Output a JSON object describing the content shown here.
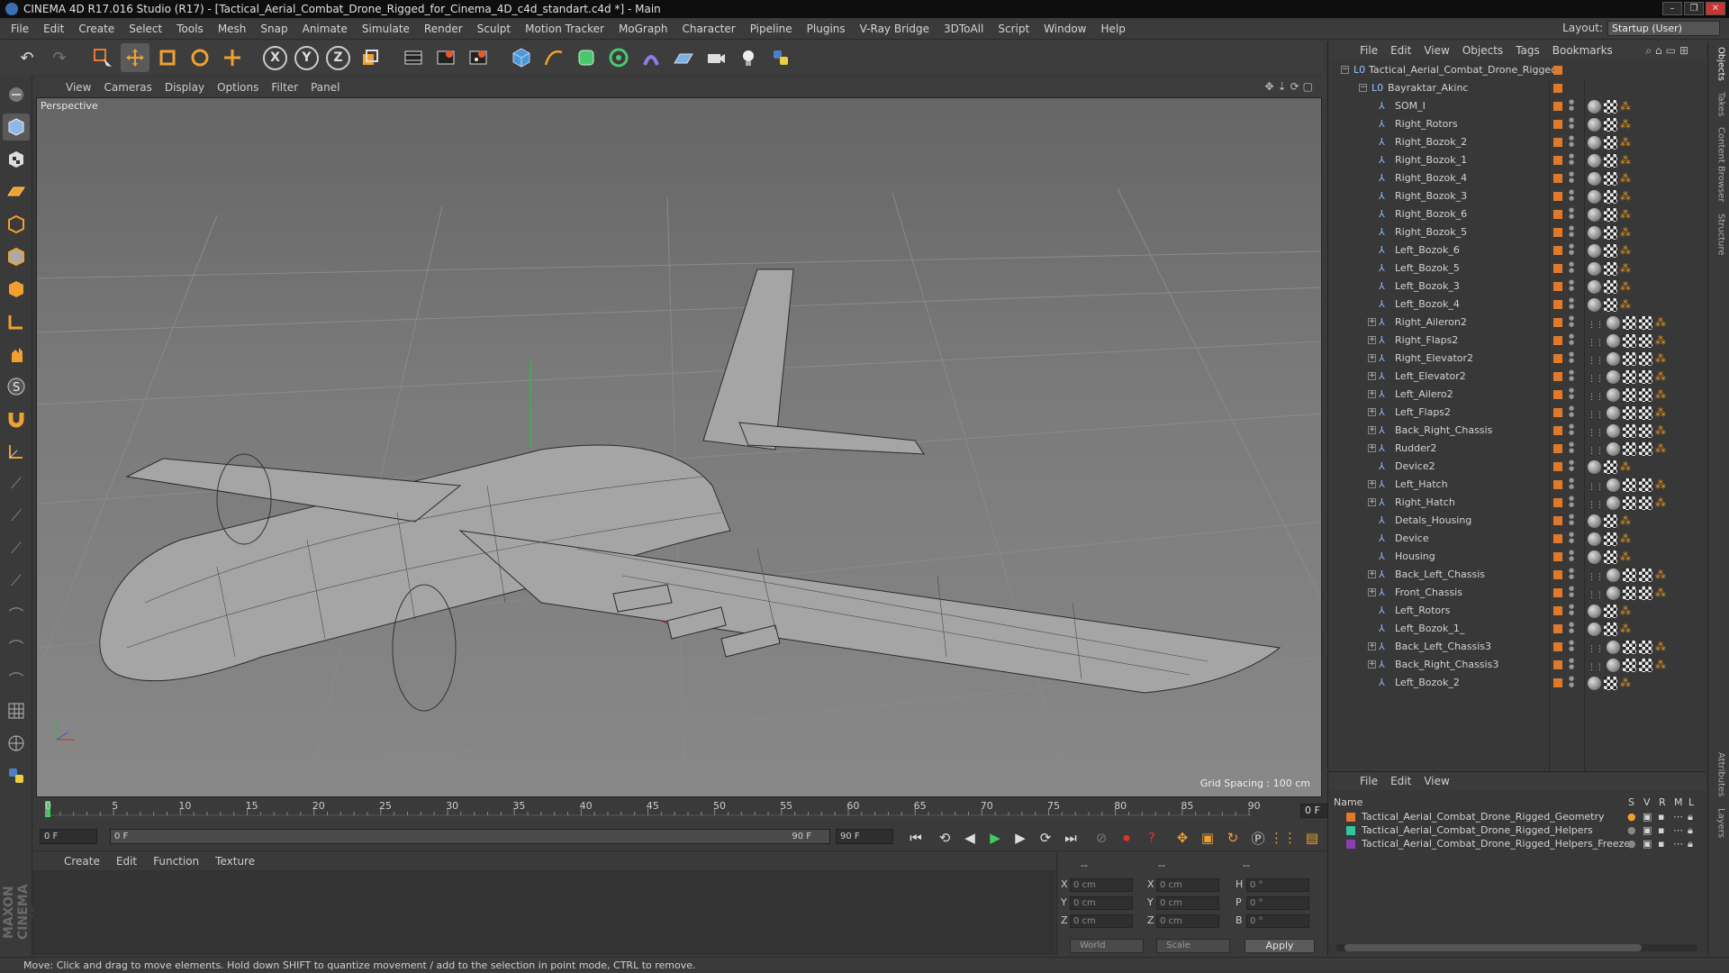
{
  "window": {
    "title": "CINEMA 4D R17.016 Studio (R17) - [Tactical_Aerial_Combat_Drone_Rigged_for_Cinema_4D_c4d_standart.c4d *] - Main"
  },
  "menu": [
    "File",
    "Edit",
    "Create",
    "Select",
    "Tools",
    "Mesh",
    "Snap",
    "Animate",
    "Simulate",
    "Render",
    "Sculpt",
    "Motion Tracker",
    "MoGraph",
    "Character",
    "Pipeline",
    "Plugins",
    "V-Ray Bridge",
    "3DToAll",
    "Script",
    "Window",
    "Help"
  ],
  "layout": {
    "label": "Layout:",
    "value": "Startup (User)"
  },
  "toolbar": {
    "undo_icon": "undo-icon",
    "redo_icon": "redo-icon",
    "live_select_icon": "live-selection-icon",
    "move_icon": "move-icon",
    "scale_icon": "scale-icon",
    "rotate_icon": "rotate-icon",
    "recent_icon": "recent-tool-icon",
    "axis_x": "X",
    "axis_y": "Y",
    "axis_z": "Z",
    "coord_icon": "coordinate-system-icon",
    "render_view_icon": "render-view-icon",
    "render_pic_icon": "render-picture-viewer-icon",
    "render_settings_icon": "render-settings-icon",
    "cube_icon": "cube-icon",
    "spline_icon": "spline-pen-icon",
    "nurbs_icon": "subdivision-icon",
    "array_icon": "array-icon",
    "deformer_icon": "deformer-icon",
    "floor_icon": "floor-icon",
    "camera_icon": "camera-icon",
    "light_icon": "light-icon",
    "python_icon": "python-icon"
  },
  "viewport": {
    "menu": [
      "View",
      "Cameras",
      "Display",
      "Options",
      "Filter",
      "Panel"
    ],
    "label": "Perspective",
    "grid_spacing": "Grid Spacing : 100 cm"
  },
  "timeline": {
    "ticks": [
      "0",
      "5",
      "10",
      "15",
      "20",
      "25",
      "30",
      "35",
      "40",
      "45",
      "50",
      "55",
      "60",
      "65",
      "70",
      "75",
      "80",
      "85",
      "90"
    ],
    "current_frame": "0 F"
  },
  "transport": {
    "start_field": "0 F",
    "range_start": "0 F",
    "range_end": "90 F",
    "end_field": "90 F"
  },
  "material_manager": {
    "menu": [
      "Create",
      "Edit",
      "Function",
      "Texture"
    ]
  },
  "coordinates": {
    "headers": [
      "--",
      "--",
      "--"
    ],
    "rows": [
      {
        "axis": "X",
        "pos": "0 cm",
        "axis2": "X",
        "size": "0 cm",
        "rl": "H",
        "rot": "0 °"
      },
      {
        "axis": "Y",
        "pos": "0 cm",
        "axis2": "Y",
        "size": "0 cm",
        "rl": "P",
        "rot": "0 °"
      },
      {
        "axis": "Z",
        "pos": "0 cm",
        "axis2": "Z",
        "size": "0 cm",
        "rl": "B",
        "rot": "0 °"
      }
    ],
    "space": "World",
    "mode": "Scale",
    "apply": "Apply"
  },
  "status": "Move: Click and drag to move elements. Hold down SHIFT to quantize movement / add to the selection in point mode, CTRL to remove.",
  "object_manager": {
    "menu": [
      "File",
      "Edit",
      "View",
      "Objects",
      "Tags",
      "Bookmarks"
    ],
    "root": "Tactical_Aerial_Combat_Drone_Rigged",
    "child": "Bayraktar_Akinc",
    "items": [
      {
        "name": "SOM_I",
        "expand": false
      },
      {
        "name": "Right_Rotors",
        "expand": false
      },
      {
        "name": "Right_Bozok_2",
        "expand": false
      },
      {
        "name": "Right_Bozok_1",
        "expand": false
      },
      {
        "name": "Right_Bozok_4",
        "expand": false
      },
      {
        "name": "Right_Bozok_3",
        "expand": false
      },
      {
        "name": "Right_Bozok_6",
        "expand": false
      },
      {
        "name": "Right_Bozok_5",
        "expand": false
      },
      {
        "name": "Left_Bozok_6",
        "expand": false
      },
      {
        "name": "Left_Bozok_5",
        "expand": false
      },
      {
        "name": "Left_Bozok_3",
        "expand": false
      },
      {
        "name": "Left_Bozok_4",
        "expand": false
      },
      {
        "name": "Right_Aileron2",
        "expand": true
      },
      {
        "name": "Right_Flaps2",
        "expand": true
      },
      {
        "name": "Right_Elevator2",
        "expand": true
      },
      {
        "name": "Left_Elevator2",
        "expand": true
      },
      {
        "name": "Left_Ailero2",
        "expand": true
      },
      {
        "name": "Left_Flaps2",
        "expand": true
      },
      {
        "name": "Back_Right_Chassis",
        "expand": true
      },
      {
        "name": "Rudder2",
        "expand": true
      },
      {
        "name": "Device2",
        "expand": false
      },
      {
        "name": "Left_Hatch",
        "expand": true
      },
      {
        "name": "Right_Hatch",
        "expand": true
      },
      {
        "name": "Detals_Housing",
        "expand": false
      },
      {
        "name": "Device",
        "expand": false
      },
      {
        "name": "Housing",
        "expand": false
      },
      {
        "name": "Back_Left_Chassis",
        "expand": true
      },
      {
        "name": "Front_Chassis",
        "expand": true
      },
      {
        "name": "Left_Rotors",
        "expand": false
      },
      {
        "name": "Left_Bozok_1_",
        "expand": false
      },
      {
        "name": "Back_Left_Chassis3",
        "expand": true
      },
      {
        "name": "Back_Right_Chassis3",
        "expand": true
      },
      {
        "name": "Left_Bozok_2",
        "expand": false
      }
    ]
  },
  "layer_manager": {
    "menu": [
      "File",
      "Edit",
      "View"
    ],
    "columns": {
      "name": "Name",
      "s": "S",
      "v": "V",
      "r": "R",
      "m": "M",
      "l": "L"
    },
    "layers": [
      {
        "name": "Tactical_Aerial_Combat_Drone_Rigged_Geometry",
        "color": "#e07a2a"
      },
      {
        "name": "Tactical_Aerial_Combat_Drone_Rigged_Helpers",
        "color": "#2fc6a0"
      },
      {
        "name": "Tactical_Aerial_Combat_Drone_Rigged_Helpers_Freeze",
        "color": "#8a3fb0"
      }
    ]
  },
  "side_tabs": [
    "Objects",
    "Takes",
    "Content Browser",
    "Structure",
    "Attributes",
    "Layers"
  ],
  "brand": "MAXON CINEMA 4D"
}
